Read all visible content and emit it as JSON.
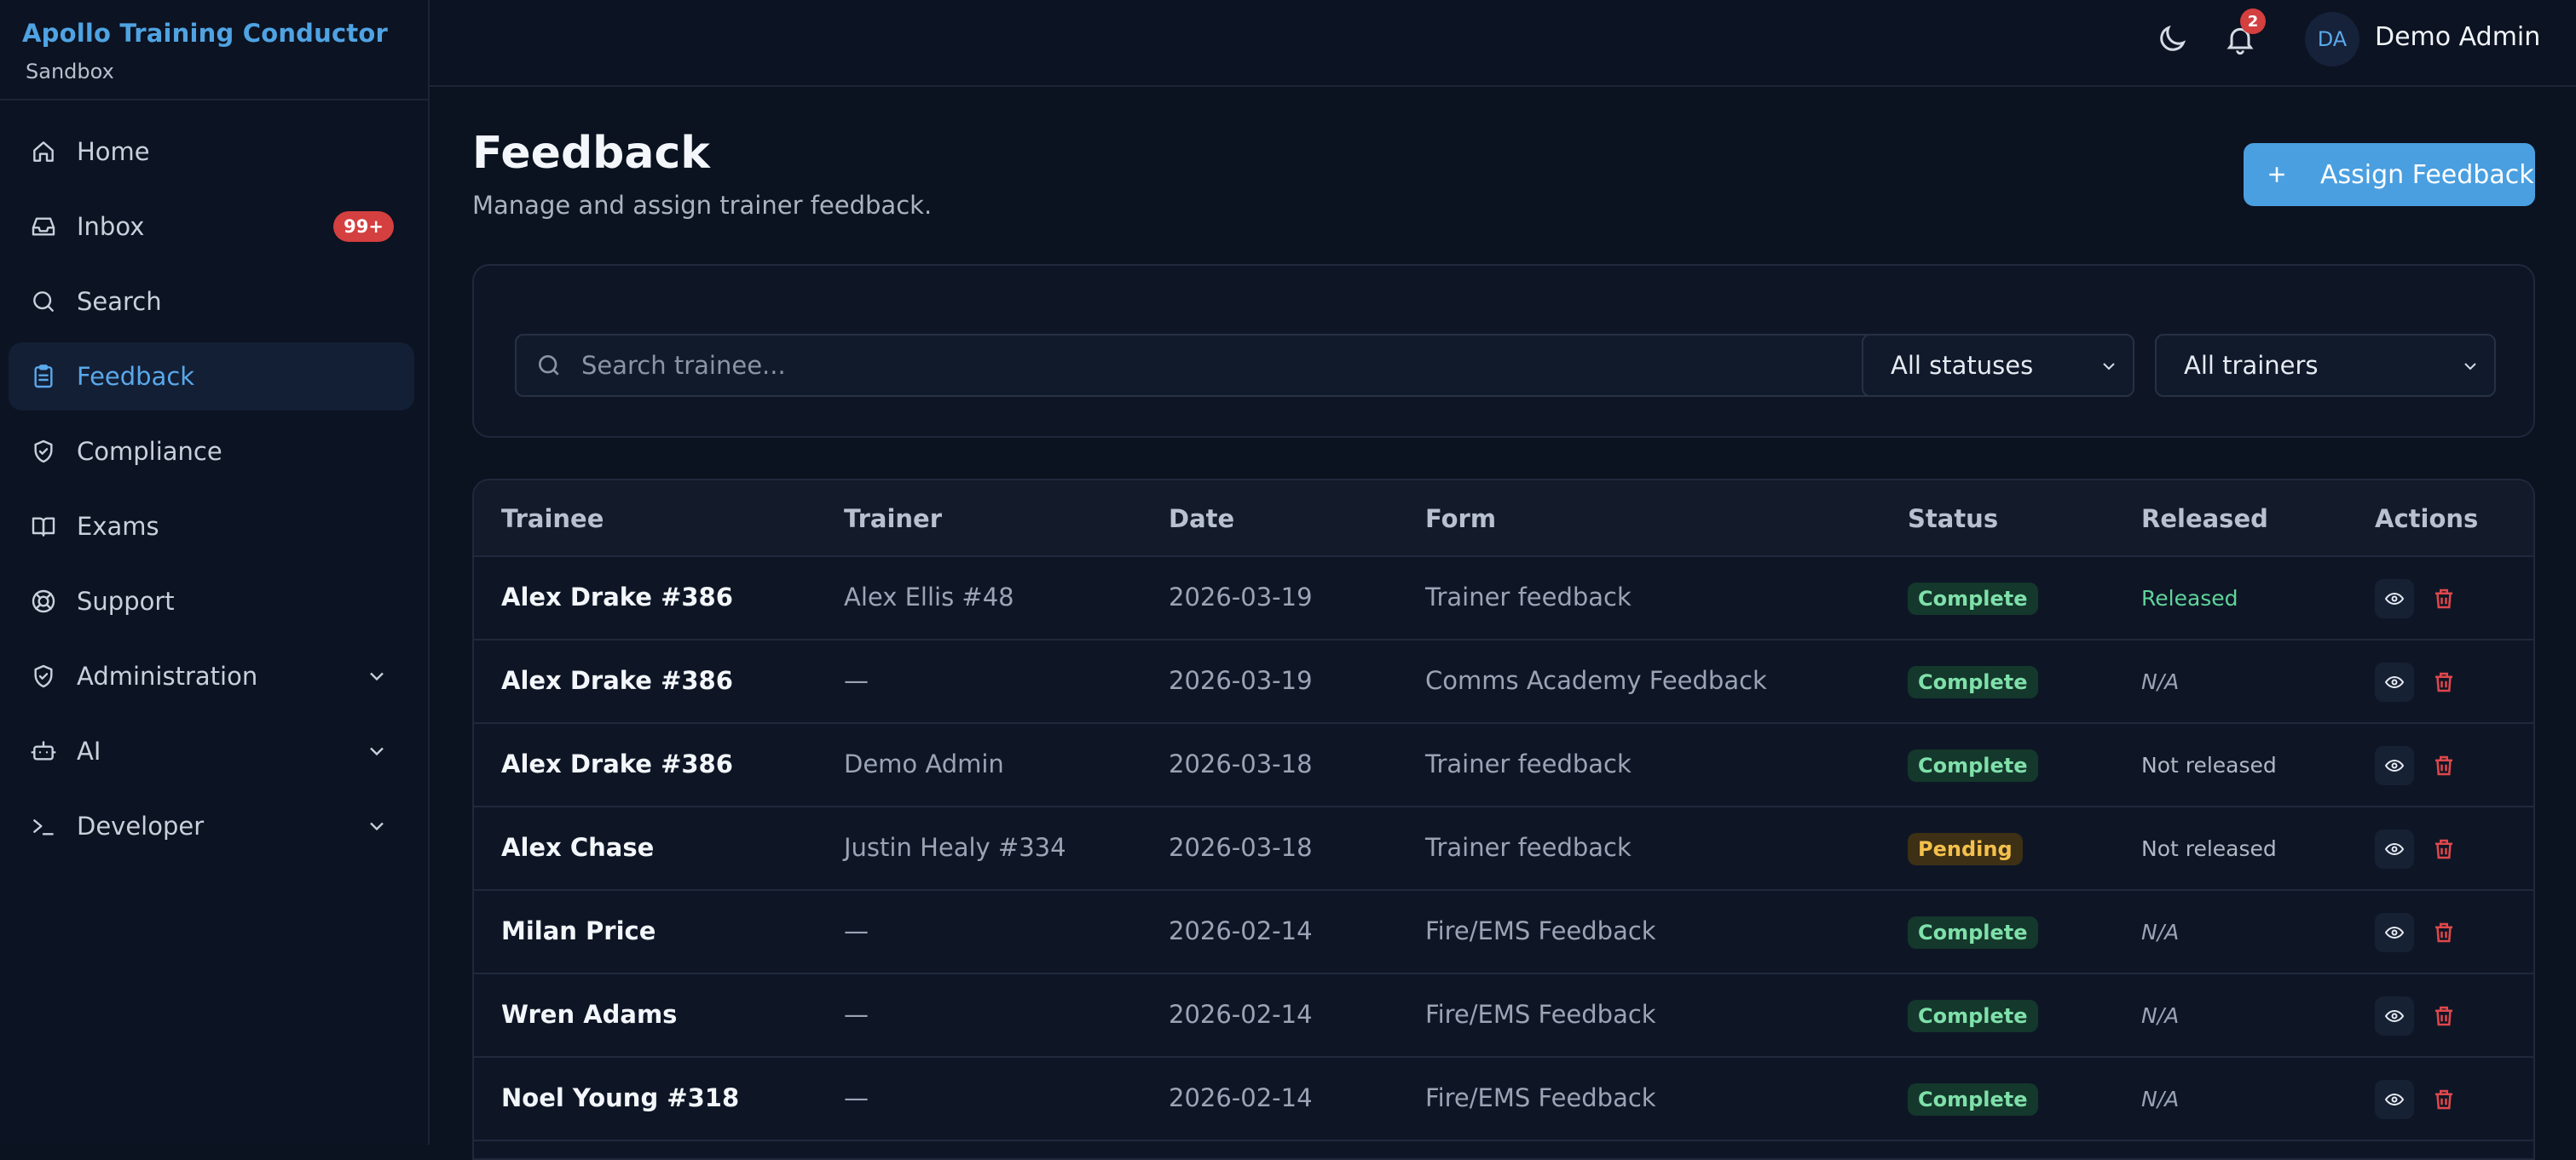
{
  "sidebar": {
    "brand_title": "Apollo Training Conductor",
    "brand_sub": "Sandbox",
    "items": [
      {
        "label": "Home",
        "icon": "home-icon"
      },
      {
        "label": "Inbox",
        "icon": "inbox-icon",
        "badge": "99+"
      },
      {
        "label": "Search",
        "icon": "search-icon"
      },
      {
        "label": "Feedback",
        "icon": "clipboard-icon",
        "active": true
      },
      {
        "label": "Compliance",
        "icon": "shield-check-icon"
      },
      {
        "label": "Exams",
        "icon": "book-icon"
      },
      {
        "label": "Support",
        "icon": "lifebuoy-icon"
      },
      {
        "label": "Administration",
        "icon": "shield-icon",
        "expandable": true
      },
      {
        "label": "AI",
        "icon": "bot-icon",
        "expandable": true
      },
      {
        "label": "Developer",
        "icon": "terminal-icon",
        "expandable": true
      }
    ]
  },
  "topbar": {
    "notification_count": "2",
    "avatar_initials": "DA",
    "user_name": "Demo Admin"
  },
  "page": {
    "title": "Feedback",
    "subtitle": "Manage and assign trainer feedback.",
    "assign_button": "Assign Feedback"
  },
  "filters": {
    "search_placeholder": "Search trainee...",
    "status_select": "All statuses",
    "trainer_select": "All trainers"
  },
  "table": {
    "headers": [
      "Trainee",
      "Trainer",
      "Date",
      "Form",
      "Status",
      "Released",
      "Actions"
    ],
    "rows": [
      {
        "trainee": "Alex Drake #386",
        "trainer": "Alex Ellis #48",
        "date": "2026-03-19",
        "form": "Trainer feedback",
        "status": "Complete",
        "released": "Released"
      },
      {
        "trainee": "Alex Drake #386",
        "trainer": "—",
        "date": "2026-03-19",
        "form": "Comms Academy Feedback",
        "status": "Complete",
        "released": "N/A"
      },
      {
        "trainee": "Alex Drake #386",
        "trainer": "Demo Admin",
        "date": "2026-03-18",
        "form": "Trainer feedback",
        "status": "Complete",
        "released": "Not released"
      },
      {
        "trainee": "Alex Chase",
        "trainer": "Justin Healy #334",
        "date": "2026-03-18",
        "form": "Trainer feedback",
        "status": "Pending",
        "released": "Not released"
      },
      {
        "trainee": "Milan Price",
        "trainer": "—",
        "date": "2026-02-14",
        "form": "Fire/EMS Feedback",
        "status": "Complete",
        "released": "N/A"
      },
      {
        "trainee": "Wren Adams",
        "trainer": "—",
        "date": "2026-02-14",
        "form": "Fire/EMS Feedback",
        "status": "Complete",
        "released": "N/A"
      },
      {
        "trainee": "Noel Young #318",
        "trainer": "—",
        "date": "2026-02-14",
        "form": "Fire/EMS Feedback",
        "status": "Complete",
        "released": "N/A"
      }
    ]
  },
  "colors": {
    "accent": "#4a9fe0",
    "background": "#0b1220",
    "danger": "#d43f3f",
    "complete": "#7fe0aa",
    "pending": "#f4c04d"
  }
}
